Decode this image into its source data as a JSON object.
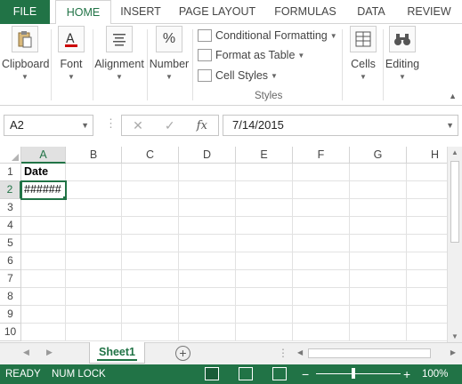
{
  "tabs": {
    "file": "FILE",
    "home": "HOME",
    "insert": "INSERT",
    "page_layout": "PAGE LAYOUT",
    "formulas": "FORMULAS",
    "data": "DATA",
    "review": "REVIEW"
  },
  "ribbon": {
    "clipboard": "Clipboard",
    "font": "Font",
    "alignment": "Alignment",
    "number": "Number",
    "conditional_formatting": "Conditional Formatting",
    "format_as_table": "Format as Table",
    "cell_styles": "Cell Styles",
    "styles_group": "Styles",
    "cells": "Cells",
    "editing": "Editing"
  },
  "formula_bar": {
    "name_box": "A2",
    "content": "7/14/2015",
    "fx": "fx"
  },
  "grid": {
    "columns": [
      "A",
      "B",
      "C",
      "D",
      "E",
      "F",
      "G",
      "H"
    ],
    "rows": [
      "1",
      "2",
      "3",
      "4",
      "5",
      "6",
      "7",
      "8",
      "9",
      "10"
    ],
    "A1": "Date",
    "A2": "######"
  },
  "sheets": {
    "active": "Sheet1"
  },
  "status": {
    "ready": "READY",
    "num_lock": "NUM LOCK",
    "zoom": "100%"
  },
  "colors": {
    "accent": "#217346"
  }
}
